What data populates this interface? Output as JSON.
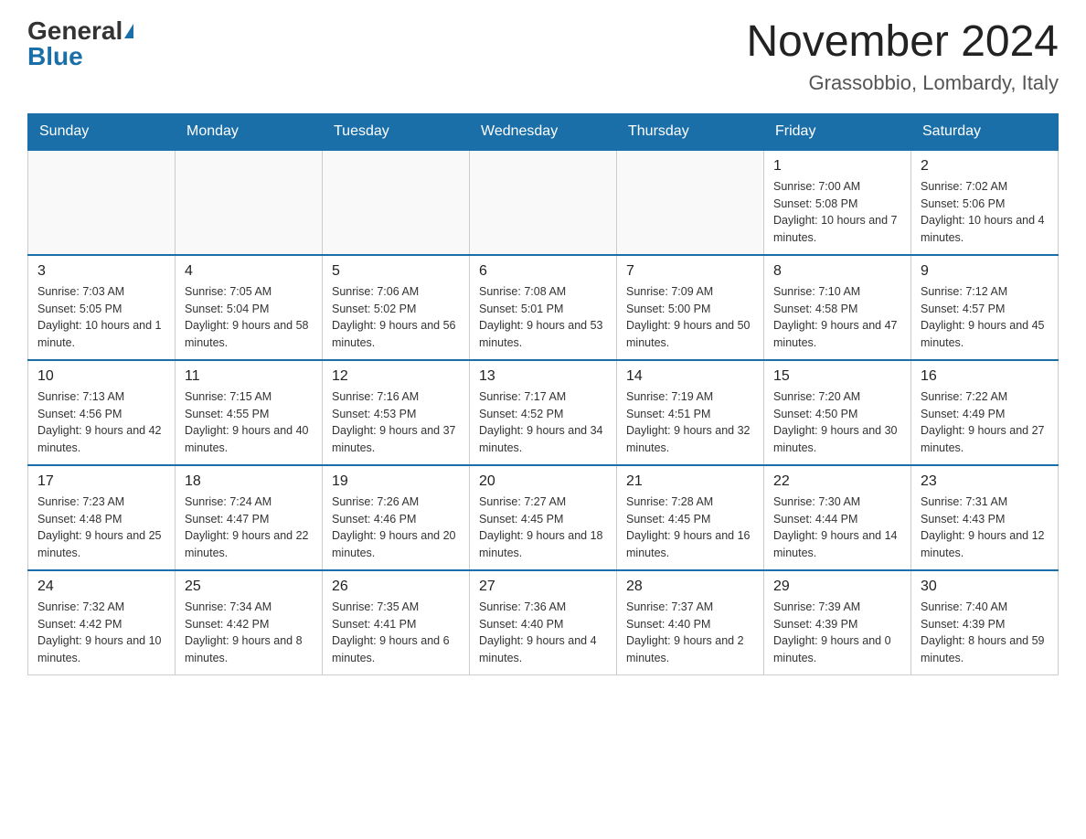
{
  "header": {
    "logo_general": "General",
    "logo_blue": "Blue",
    "month_title": "November 2024",
    "location": "Grassobbio, Lombardy, Italy"
  },
  "days_of_week": [
    "Sunday",
    "Monday",
    "Tuesday",
    "Wednesday",
    "Thursday",
    "Friday",
    "Saturday"
  ],
  "weeks": [
    [
      {
        "day": "",
        "info": ""
      },
      {
        "day": "",
        "info": ""
      },
      {
        "day": "",
        "info": ""
      },
      {
        "day": "",
        "info": ""
      },
      {
        "day": "",
        "info": ""
      },
      {
        "day": "1",
        "info": "Sunrise: 7:00 AM\nSunset: 5:08 PM\nDaylight: 10 hours and 7 minutes."
      },
      {
        "day": "2",
        "info": "Sunrise: 7:02 AM\nSunset: 5:06 PM\nDaylight: 10 hours and 4 minutes."
      }
    ],
    [
      {
        "day": "3",
        "info": "Sunrise: 7:03 AM\nSunset: 5:05 PM\nDaylight: 10 hours and 1 minute."
      },
      {
        "day": "4",
        "info": "Sunrise: 7:05 AM\nSunset: 5:04 PM\nDaylight: 9 hours and 58 minutes."
      },
      {
        "day": "5",
        "info": "Sunrise: 7:06 AM\nSunset: 5:02 PM\nDaylight: 9 hours and 56 minutes."
      },
      {
        "day": "6",
        "info": "Sunrise: 7:08 AM\nSunset: 5:01 PM\nDaylight: 9 hours and 53 minutes."
      },
      {
        "day": "7",
        "info": "Sunrise: 7:09 AM\nSunset: 5:00 PM\nDaylight: 9 hours and 50 minutes."
      },
      {
        "day": "8",
        "info": "Sunrise: 7:10 AM\nSunset: 4:58 PM\nDaylight: 9 hours and 47 minutes."
      },
      {
        "day": "9",
        "info": "Sunrise: 7:12 AM\nSunset: 4:57 PM\nDaylight: 9 hours and 45 minutes."
      }
    ],
    [
      {
        "day": "10",
        "info": "Sunrise: 7:13 AM\nSunset: 4:56 PM\nDaylight: 9 hours and 42 minutes."
      },
      {
        "day": "11",
        "info": "Sunrise: 7:15 AM\nSunset: 4:55 PM\nDaylight: 9 hours and 40 minutes."
      },
      {
        "day": "12",
        "info": "Sunrise: 7:16 AM\nSunset: 4:53 PM\nDaylight: 9 hours and 37 minutes."
      },
      {
        "day": "13",
        "info": "Sunrise: 7:17 AM\nSunset: 4:52 PM\nDaylight: 9 hours and 34 minutes."
      },
      {
        "day": "14",
        "info": "Sunrise: 7:19 AM\nSunset: 4:51 PM\nDaylight: 9 hours and 32 minutes."
      },
      {
        "day": "15",
        "info": "Sunrise: 7:20 AM\nSunset: 4:50 PM\nDaylight: 9 hours and 30 minutes."
      },
      {
        "day": "16",
        "info": "Sunrise: 7:22 AM\nSunset: 4:49 PM\nDaylight: 9 hours and 27 minutes."
      }
    ],
    [
      {
        "day": "17",
        "info": "Sunrise: 7:23 AM\nSunset: 4:48 PM\nDaylight: 9 hours and 25 minutes."
      },
      {
        "day": "18",
        "info": "Sunrise: 7:24 AM\nSunset: 4:47 PM\nDaylight: 9 hours and 22 minutes."
      },
      {
        "day": "19",
        "info": "Sunrise: 7:26 AM\nSunset: 4:46 PM\nDaylight: 9 hours and 20 minutes."
      },
      {
        "day": "20",
        "info": "Sunrise: 7:27 AM\nSunset: 4:45 PM\nDaylight: 9 hours and 18 minutes."
      },
      {
        "day": "21",
        "info": "Sunrise: 7:28 AM\nSunset: 4:45 PM\nDaylight: 9 hours and 16 minutes."
      },
      {
        "day": "22",
        "info": "Sunrise: 7:30 AM\nSunset: 4:44 PM\nDaylight: 9 hours and 14 minutes."
      },
      {
        "day": "23",
        "info": "Sunrise: 7:31 AM\nSunset: 4:43 PM\nDaylight: 9 hours and 12 minutes."
      }
    ],
    [
      {
        "day": "24",
        "info": "Sunrise: 7:32 AM\nSunset: 4:42 PM\nDaylight: 9 hours and 10 minutes."
      },
      {
        "day": "25",
        "info": "Sunrise: 7:34 AM\nSunset: 4:42 PM\nDaylight: 9 hours and 8 minutes."
      },
      {
        "day": "26",
        "info": "Sunrise: 7:35 AM\nSunset: 4:41 PM\nDaylight: 9 hours and 6 minutes."
      },
      {
        "day": "27",
        "info": "Sunrise: 7:36 AM\nSunset: 4:40 PM\nDaylight: 9 hours and 4 minutes."
      },
      {
        "day": "28",
        "info": "Sunrise: 7:37 AM\nSunset: 4:40 PM\nDaylight: 9 hours and 2 minutes."
      },
      {
        "day": "29",
        "info": "Sunrise: 7:39 AM\nSunset: 4:39 PM\nDaylight: 9 hours and 0 minutes."
      },
      {
        "day": "30",
        "info": "Sunrise: 7:40 AM\nSunset: 4:39 PM\nDaylight: 8 hours and 59 minutes."
      }
    ]
  ]
}
